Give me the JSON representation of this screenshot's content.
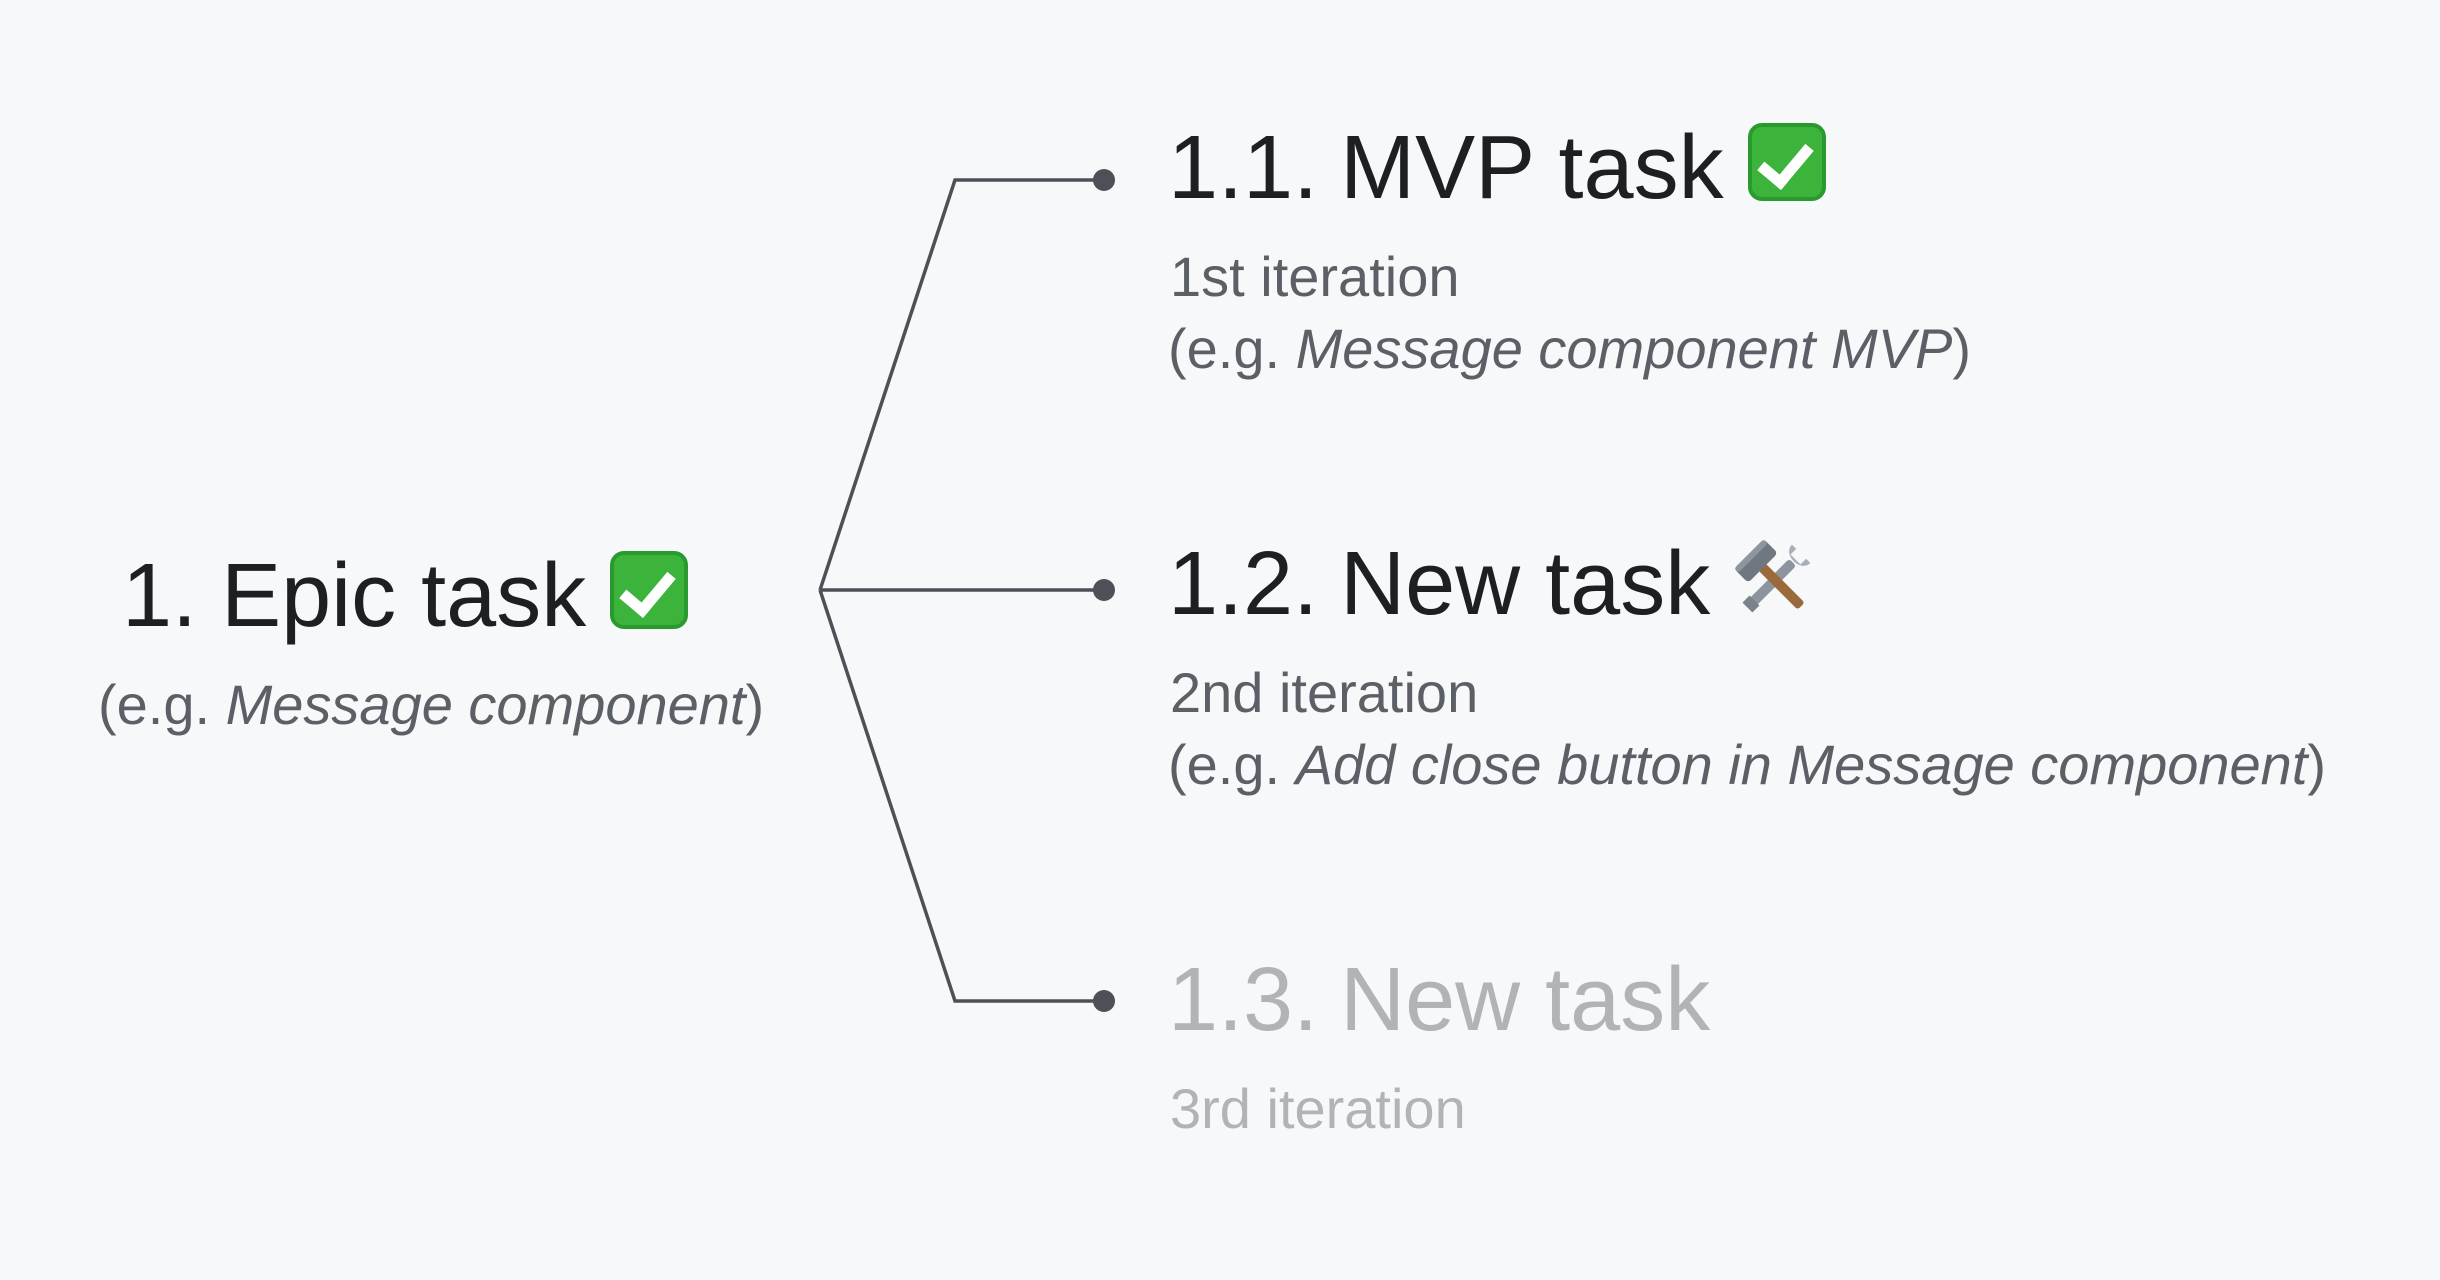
{
  "colors": {
    "background": "#f7f8fa",
    "title": "#1d1f22",
    "secondary": "#5b5f66",
    "muted": "#b1b3b6",
    "connector": "#4d5157",
    "check_green": "#3cb43c"
  },
  "epic": {
    "number": "1.",
    "title": "Epic task",
    "status_icon": "check-mark-button-icon",
    "example_prefix": "(e.g. ",
    "example_text": "Message component",
    "example_suffix": ")"
  },
  "subtasks": [
    {
      "number": "1.1.",
      "title": "MVP task",
      "status_icon": "check-mark-button-icon",
      "iteration": "1st iteration",
      "example_prefix": "(e.g. ",
      "example_text": "Message component MVP",
      "example_suffix": ")"
    },
    {
      "number": "1.2.",
      "title": "New task",
      "status_icon": "hammer-and-wrench-icon",
      "iteration": "2nd iteration",
      "example_prefix": "(e.g. ",
      "example_text": "Add close button in Message component",
      "example_suffix": ")"
    },
    {
      "number": "1.3.",
      "title": "New task",
      "status_icon": "",
      "iteration": "3rd iteration"
    }
  ]
}
